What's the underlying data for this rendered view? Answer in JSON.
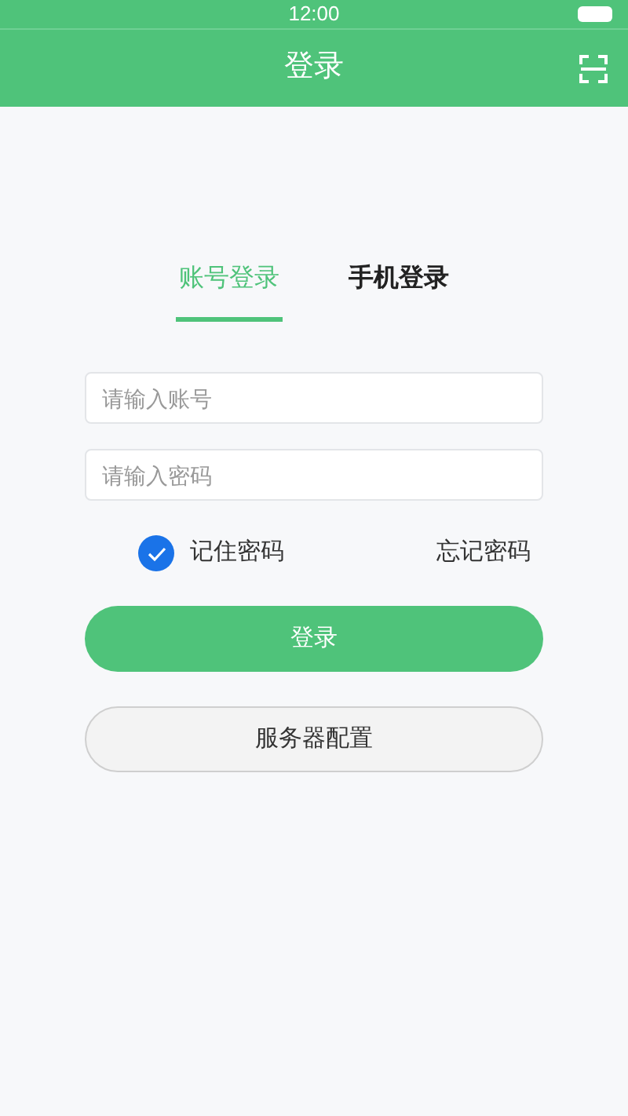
{
  "status_bar": {
    "time": "12:00"
  },
  "header": {
    "title": "登录"
  },
  "tabs": [
    {
      "label": "账号登录",
      "selected": true
    },
    {
      "label": "手机登录",
      "selected": false
    }
  ],
  "account_field": {
    "placeholder": "请输入账号"
  },
  "password_field": {
    "placeholder": "请输入密码"
  },
  "remember": {
    "label": "记住密码",
    "checked": true
  },
  "forgot_link": "忘记密码",
  "login_button": "登录",
  "server_button": "服务器配置"
}
